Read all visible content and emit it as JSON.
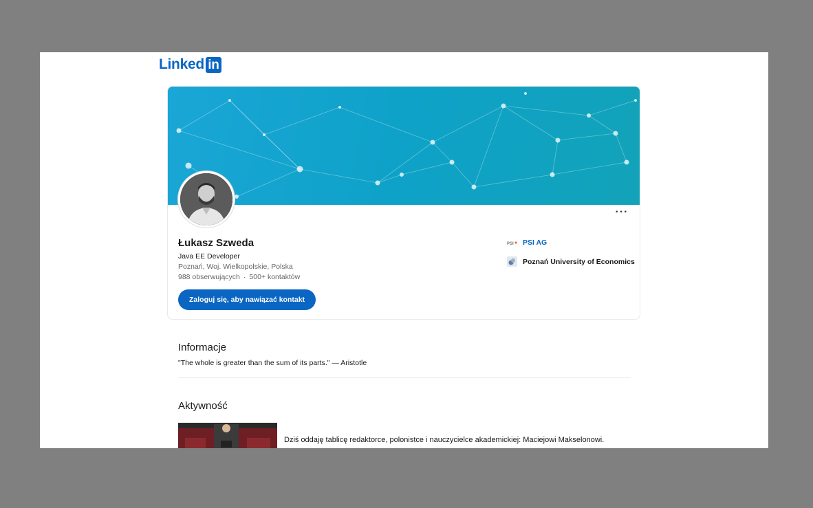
{
  "logo": {
    "text": "Linked",
    "box": "in"
  },
  "profile": {
    "name": "Łukasz Szweda",
    "headline": "Java EE Developer",
    "location": "Poznań, Woj. Wielkopolskie, Polska",
    "followers": "988 obserwujących",
    "separator": "·",
    "connections": "500+ kontaktów",
    "connect_button": "Zaloguj się, aby nawiązać kontakt",
    "more_label": "···"
  },
  "experience": [
    {
      "icon_text": "PSI",
      "label": "PSI AG"
    },
    {
      "label": "Poznań University of Economics"
    }
  ],
  "about": {
    "title": "Informacje",
    "text": "\"The whole is greater than the sum of its parts.\" — Aristotle"
  },
  "activity": {
    "title": "Aktywność",
    "post_text": "Dziś oddaję tablicę redaktorce, polonistce i nauczycielce akademickiej: Maciejowi Makselonowi."
  },
  "colors": {
    "brand": "#0a66c2",
    "banner": "#0ea2c8",
    "backdrop": "#808080"
  }
}
